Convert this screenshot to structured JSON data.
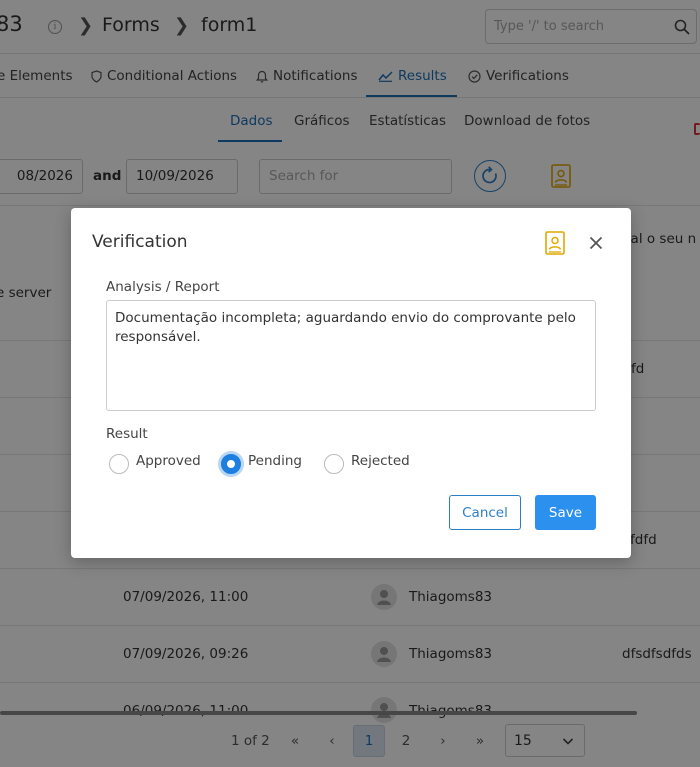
{
  "header": {
    "project_id": "83",
    "crumb_forms": "Forms",
    "crumb_form": "form1",
    "search_placeholder": "Type '/' to search"
  },
  "tabs": [
    {
      "label": "e Elements"
    },
    {
      "label": "Conditional Actions"
    },
    {
      "label": "Notifications"
    },
    {
      "label": "Results"
    },
    {
      "label": "Verifications"
    }
  ],
  "subtabs": [
    {
      "label": "Dados"
    },
    {
      "label": "Gráficos"
    },
    {
      "label": "Estatísticas"
    },
    {
      "label": "Download de fotos"
    }
  ],
  "filter": {
    "date_from": "08/2026",
    "and_label": "and",
    "date_to": "10/09/2026",
    "search_placeholder": "Search for"
  },
  "table": {
    "header_partial_right": "ual o seu n",
    "header_partial_left": "e server",
    "partial_cells": [
      "fd",
      "fdfd"
    ],
    "rows": [
      {
        "date": "07/09/2026, 11:00",
        "user": "Thiagoms83",
        "extra": ""
      },
      {
        "date": "07/09/2026, 09:26",
        "user": "Thiagoms83",
        "extra": "dfsdfsdfds"
      },
      {
        "date": "06/09/2026, 11:00",
        "user": "Thiagoms83",
        "extra": ""
      }
    ]
  },
  "pagination": {
    "summary": "1 of 2",
    "first": "«",
    "prev": "‹",
    "pages": [
      "1",
      "2"
    ],
    "next": "›",
    "last": "»",
    "page_size": "15"
  },
  "modal": {
    "title": "Verification",
    "analysis_label": "Analysis / Report",
    "analysis_text": "Documentação incompleta; aguardando envio do comprovante pelo responsável.",
    "result_label": "Result",
    "options": [
      {
        "label": "Approved"
      },
      {
        "label": "Pending"
      },
      {
        "label": "Rejected"
      }
    ],
    "selected": "Pending",
    "cancel_label": "Cancel",
    "save_label": "Save"
  },
  "colors": {
    "accent": "#1d6fb8",
    "primary_button": "#2c90ef",
    "export_icon": "#e0a800",
    "alert_red": "#d33333"
  }
}
